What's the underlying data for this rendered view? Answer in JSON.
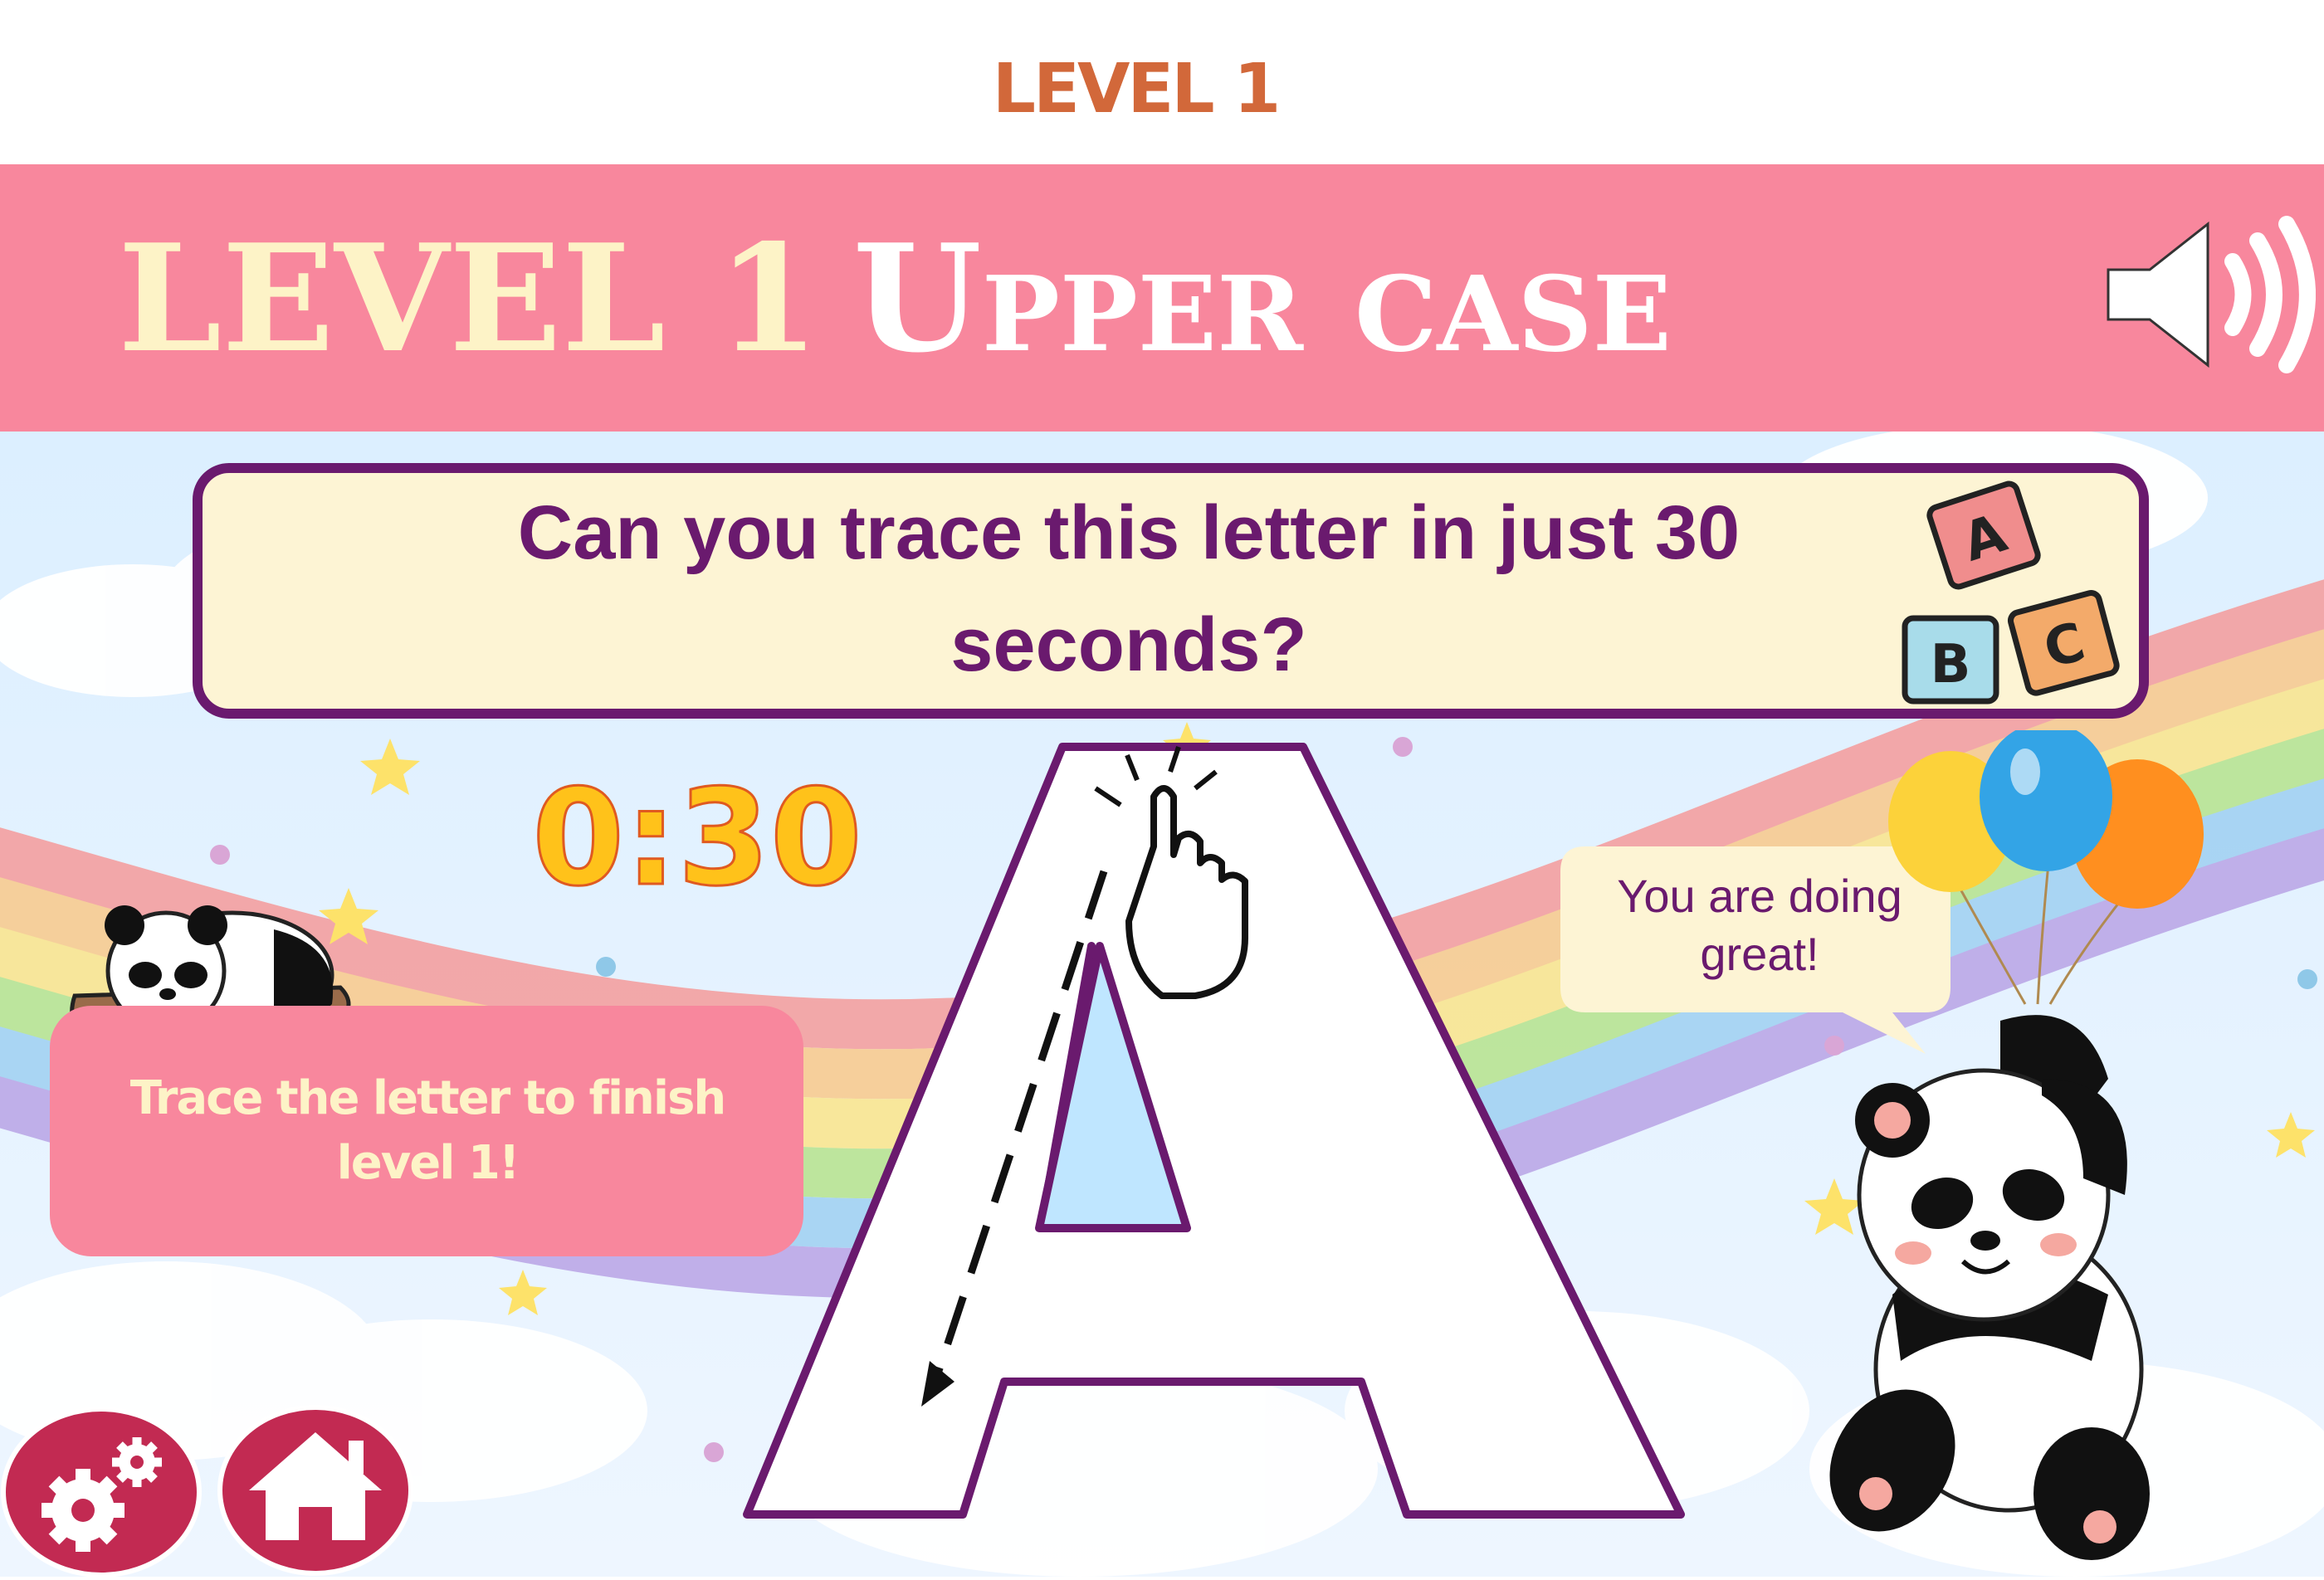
{
  "top_label": "LEVEL 1",
  "header": {
    "title_part1": "LEVEL 1",
    "title_part2": "Upper case"
  },
  "question": {
    "text": "Can you trace this letter in just 30 seconds?",
    "blocks": [
      "A",
      "B",
      "C"
    ]
  },
  "timer": "0:30",
  "hint": "Trace the letter to finish level 1!",
  "bubble": "You are doing great!",
  "trace_letter": "A",
  "icons": {
    "sound": "speaker-volume-icon",
    "settings": "gears-icon",
    "home": "home-icon",
    "hand": "pointing-hand-icon"
  },
  "colors": {
    "header_band": "#f8879d",
    "title_cream": "#fdf3c7",
    "title_white": "#ffffff",
    "top_label": "#d2683a",
    "question_text": "#6a1a6e",
    "question_box_fill": "#fdf4d4",
    "timer_fill": "#ffc21a",
    "hint_box": "#f8879d",
    "hint_text": "#fdf3c7",
    "letter_outline": "#6a1a6e",
    "button_fill": "#c22a52",
    "bubble_fill": "#fdf4d4",
    "bubble_text": "#6a1a6e"
  }
}
